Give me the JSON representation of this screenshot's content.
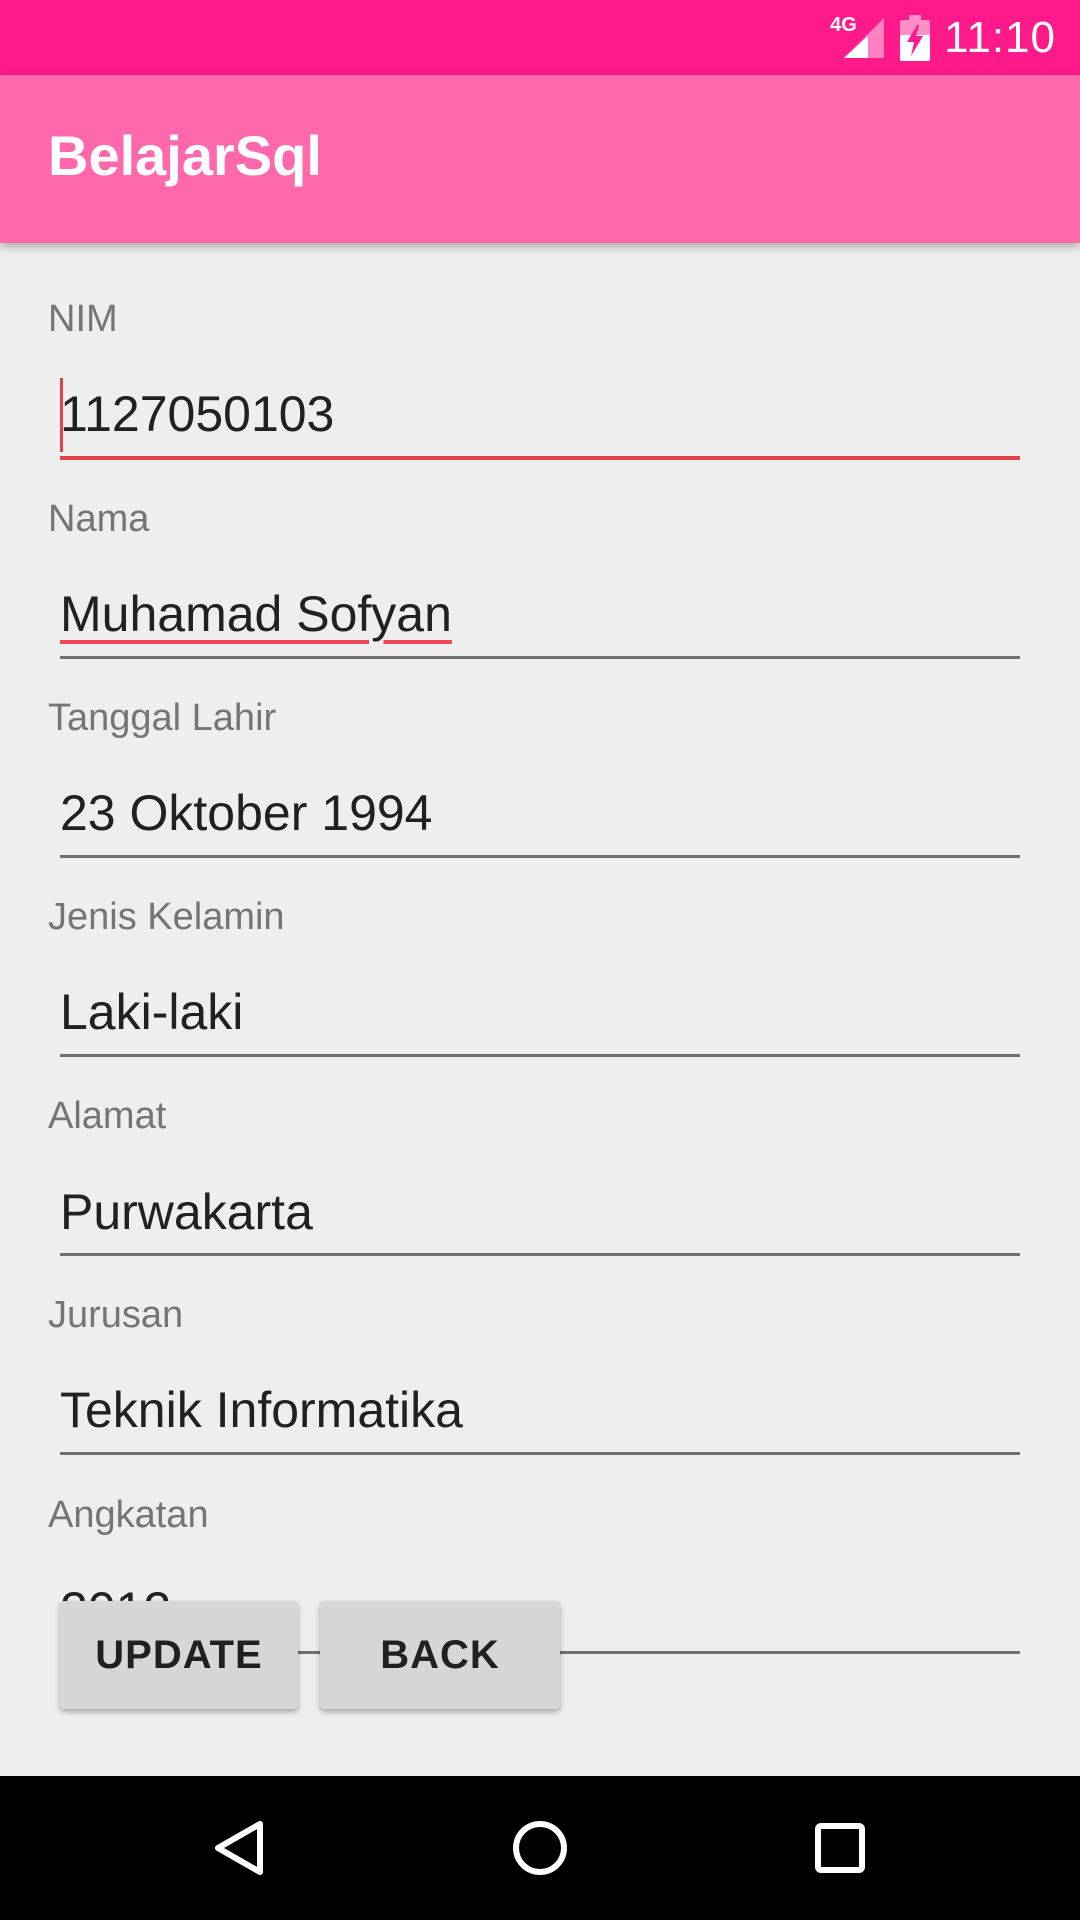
{
  "status_bar": {
    "network_label": "4G",
    "time": "11:10",
    "icons": [
      "signal-icon",
      "battery-charging-icon"
    ]
  },
  "app_bar": {
    "title": "BelajarSql"
  },
  "form": {
    "fields": [
      {
        "label": "NIM",
        "value": "1127050103"
      },
      {
        "label": "Nama",
        "value": "Muhamad Sofyan"
      },
      {
        "label": "Tanggal Lahir",
        "value": "23 Oktober 1994"
      },
      {
        "label": "Jenis Kelamin",
        "value": "Laki-laki"
      },
      {
        "label": "Alamat",
        "value": "Purwakarta"
      },
      {
        "label": "Jurusan",
        "value": "Teknik Informatika"
      },
      {
        "label": "Angkatan",
        "value": "2012"
      }
    ]
  },
  "buttons": {
    "update_label": "UPDATE",
    "back_label": "BACK"
  },
  "nav": {
    "icons": [
      "back-icon",
      "home-icon",
      "recents-icon"
    ]
  },
  "colors": {
    "status_bar": "#ff1a8c",
    "app_bar": "#ff69ab",
    "accent": "#e0424a",
    "background": "#eeeeee"
  }
}
